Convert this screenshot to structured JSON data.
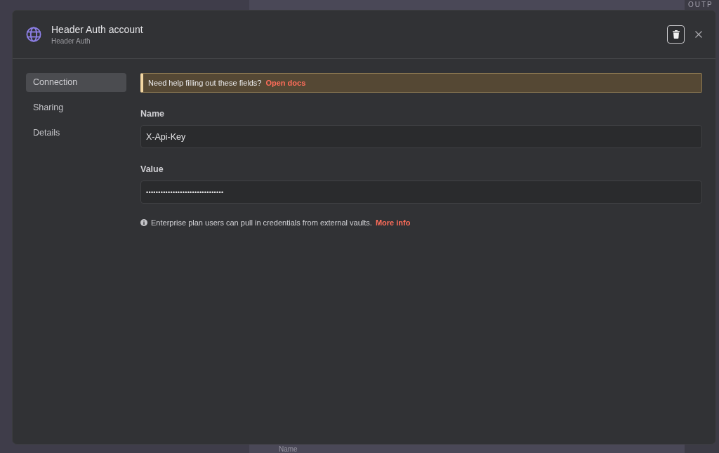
{
  "background": {
    "panel_label": "OUTP",
    "field_label": "Name"
  },
  "dialog": {
    "title": "Header Auth account",
    "subtitle": "Header Auth"
  },
  "sidebar": {
    "items": [
      {
        "label": "Connection",
        "selected": true
      },
      {
        "label": "Sharing",
        "selected": false
      },
      {
        "label": "Details",
        "selected": false
      }
    ]
  },
  "notice": {
    "text": "Need help filling out these fields?",
    "link": "Open docs"
  },
  "fields": [
    {
      "kind": "text",
      "label": "Name",
      "value": "X-Api-Key"
    },
    {
      "kind": "password",
      "label": "Value",
      "value": "••••••••••••••••••••••••••••••••"
    }
  ],
  "info": {
    "text": "Enterprise plan users can pull in credentials from external vaults.",
    "link": "More info"
  }
}
